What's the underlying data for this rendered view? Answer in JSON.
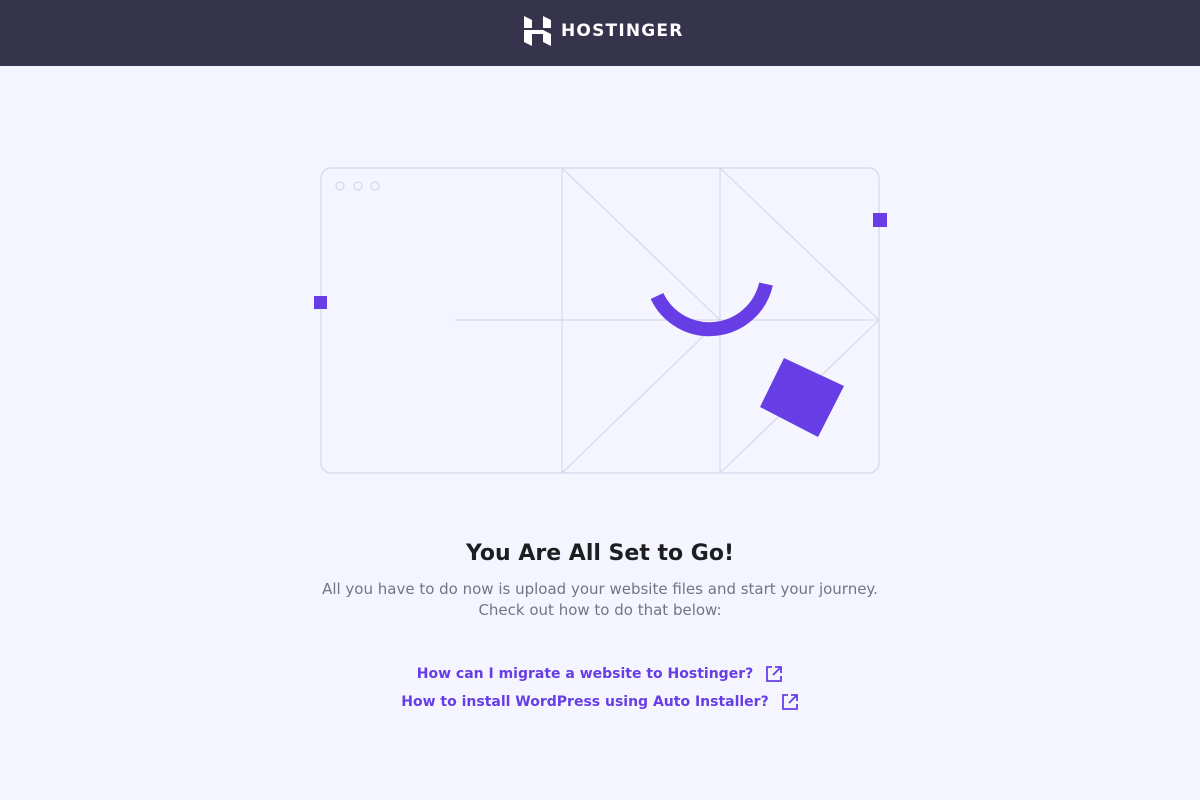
{
  "header": {
    "brand_name": "HOSTINGER",
    "logo_icon": "hostinger-logo-icon",
    "background_color": "#36344d"
  },
  "main": {
    "title": "You Are All Set to Go!",
    "subtitle_line1": "All you have to do now is upload your website files and start your journey.",
    "subtitle_line2": "Check out how to do that below:",
    "links": [
      {
        "label": "How can I migrate a website to Hostinger?",
        "icon": "external-link-icon"
      },
      {
        "label": "How to install WordPress using Auto Installer?",
        "icon": "external-link-icon"
      }
    ]
  },
  "colors": {
    "accent": "#673de6",
    "page_background": "#f4f5ff",
    "title_text": "#1d1e20",
    "body_text": "#727586",
    "line_art": "#d5d8ea"
  }
}
